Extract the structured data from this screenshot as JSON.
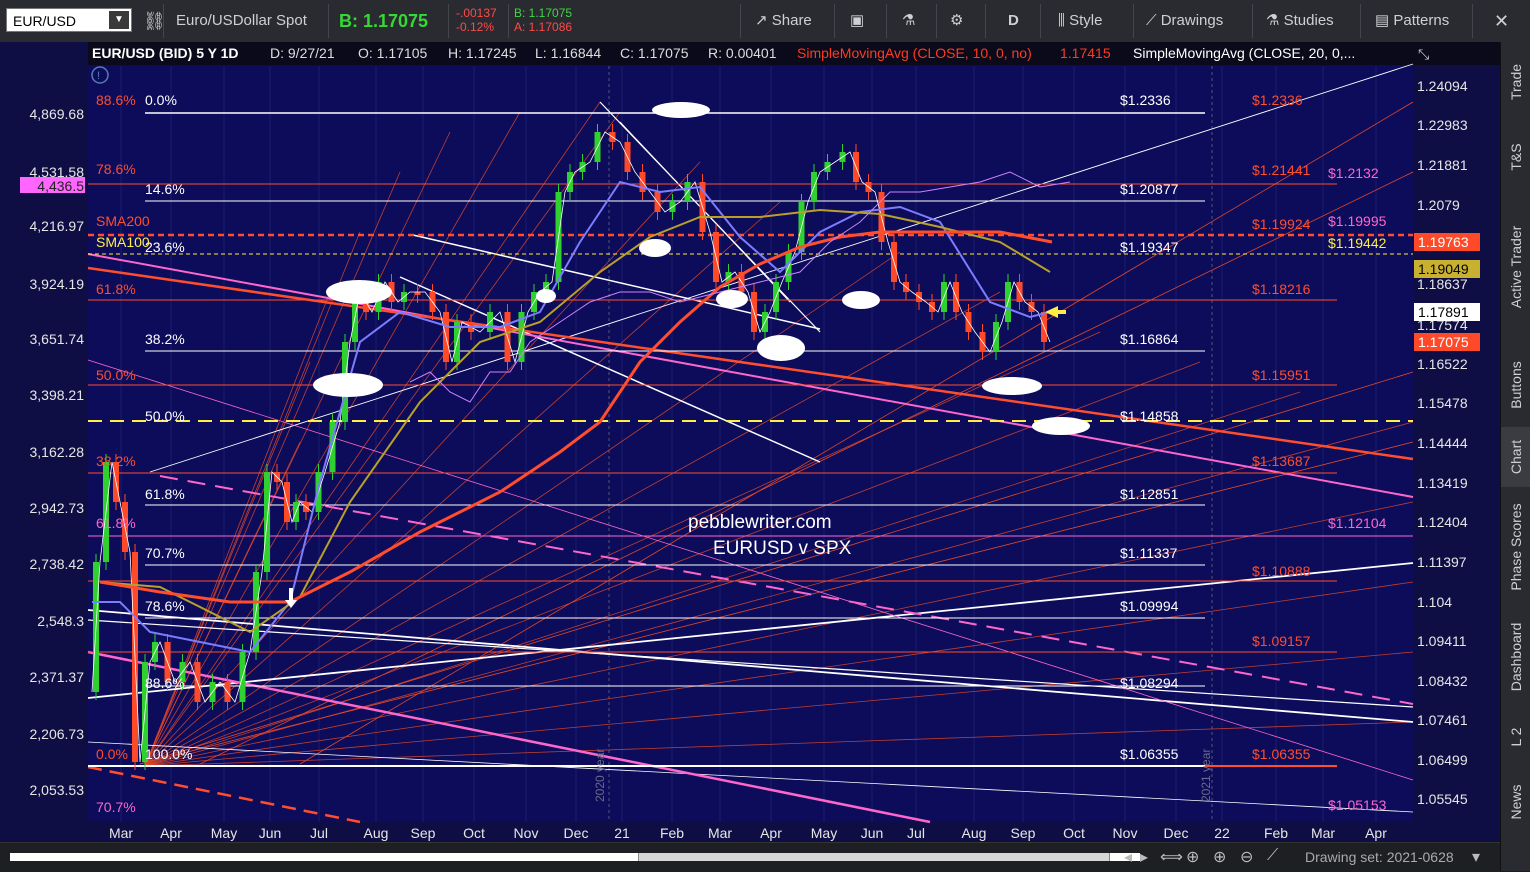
{
  "toolbar": {
    "symbol": "EUR/USD",
    "description": "Euro/USDollar Spot",
    "bid_label": "B: 1.17075",
    "change_abs": "-.00137",
    "change_pct": "-0.12%",
    "bid_small": "B: 1.17075",
    "ask_small": "A: 1.17086",
    "share": "Share",
    "period": "D",
    "style": "Style",
    "drawings": "Drawings",
    "studies": "Studies",
    "patterns": "Patterns"
  },
  "header": {
    "title": "EUR/USD (BID) 5 Y 1D",
    "date": "D: 9/27/21",
    "open": "O: 1.17105",
    "high": "H: 1.17245",
    "low": "L: 1.16844",
    "close": "C: 1.17075",
    "range": "R: 0.00401",
    "sma10": "SimpleMovingAvg (CLOSE, 10, 0, no)",
    "sma10_val": "1.17415",
    "sma20": "SimpleMovingAvg (CLOSE, 20, 0,..."
  },
  "colors": {
    "bg": "#0e0e44",
    "price": "#ff4d2e",
    "pink": "#ff66cc",
    "yellow": "#ffee44"
  },
  "left_axis": [
    "4,869.68",
    "4,531.58",
    "4,436.5",
    "4,216.97",
    "3,924.19",
    "3,651.74",
    "3,398.21",
    "3,162.28",
    "2,942.73",
    "2,738.42",
    "2,548.3",
    "2,371.37",
    "2,206.73",
    "2,053.53"
  ],
  "right_axis": [
    "1.24094",
    "1.22983",
    "1.21881",
    "1.2079",
    "1.18637",
    "1.17574",
    "1.16522",
    "1.15478",
    "1.14444",
    "1.13419",
    "1.12404",
    "1.11397",
    "1.104",
    "1.09411",
    "1.08432",
    "1.07461",
    "1.06499",
    "1.05545"
  ],
  "x_axis": [
    "Mar",
    "Apr",
    "May",
    "Jun",
    "Jul",
    "Aug",
    "Sep",
    "Oct",
    "Nov",
    "Dec",
    "21",
    "Feb",
    "Mar",
    "Apr",
    "May",
    "Jun",
    "Jul",
    "Aug",
    "Sep",
    "Oct",
    "Nov",
    "Dec",
    "22",
    "Feb",
    "Mar",
    "Apr"
  ],
  "year_labels": [
    "2020 year",
    "2021 year"
  ],
  "fib_left": [
    "0.0%",
    "14.6%",
    "23.6%",
    "38.2%",
    "50.0%",
    "61.8%",
    "70.7%",
    "78.6%",
    "88.6%",
    "100.0%"
  ],
  "fib_left2": [
    "88.6%",
    "78.6%",
    "61.8%",
    "50.0%",
    "38.2%",
    "61.8%",
    "0.0%",
    "70.7%",
    "SMA200",
    "SMA100",
    "50.0%"
  ],
  "white_levels": [
    "$1.2336",
    "$1.20877",
    "$1.19347",
    "$1.16864",
    "$1.14858",
    "$1.12851",
    "$1.11337",
    "$1.09994",
    "$1.08294",
    "$1.06355"
  ],
  "red_levels": [
    "$1.2336",
    "$1.21441",
    "$1.19924",
    "$1.18216",
    "$1.15951",
    "$1.13687",
    "$1.10888",
    "$1.09157",
    "$1.06355"
  ],
  "pink_levels": [
    "$1.2132",
    "$1.19995",
    "$1.12104",
    "$1.05153"
  ],
  "yellow_level": "$1.19442",
  "price_tags": {
    "sma200": "1.19763",
    "sma100": "1.19049",
    "sma20": "1.17891",
    "last": "1.17075"
  },
  "watermark": {
    "line1": "pebblewriter.com",
    "line2": "EURUSD v SPX"
  },
  "right_rail": [
    "Trade",
    "T&S",
    "Active Trader",
    "Buttons",
    "Chart",
    "Phase Scores",
    "Dashboard",
    "L 2",
    "News"
  ],
  "bottom": {
    "drawing_set": "Drawing set: 2021-0628"
  }
}
